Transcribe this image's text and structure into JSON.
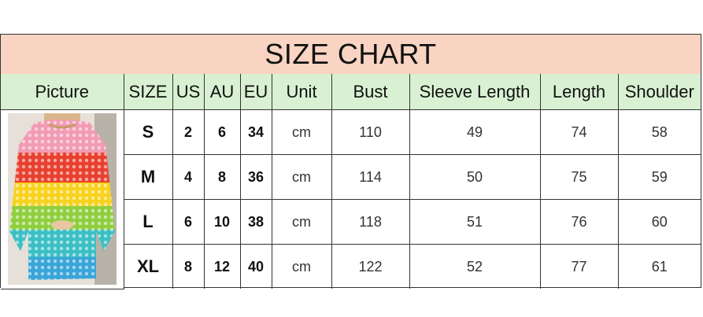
{
  "title": "SIZE CHART",
  "headers": [
    "Picture",
    "SIZE",
    "US",
    "AU",
    "EU",
    "Unit",
    "Bust",
    "Sleeve Length",
    "Length",
    "Shoulder"
  ],
  "rows": [
    {
      "size": "S",
      "us": "2",
      "au": "6",
      "eu": "34",
      "unit": "cm",
      "bust": "110",
      "sleeve": "49",
      "length": "74",
      "shoulder": "58"
    },
    {
      "size": "M",
      "us": "4",
      "au": "8",
      "eu": "36",
      "unit": "cm",
      "bust": "114",
      "sleeve": "50",
      "length": "75",
      "shoulder": "59"
    },
    {
      "size": "L",
      "us": "6",
      "au": "10",
      "eu": "38",
      "unit": "cm",
      "bust": "118",
      "sleeve": "51",
      "length": "76",
      "shoulder": "60"
    },
    {
      "size": "XL",
      "us": "8",
      "au": "12",
      "eu": "40",
      "unit": "cm",
      "bust": "122",
      "sleeve": "52",
      "length": "77",
      "shoulder": "61"
    }
  ],
  "colors": {
    "title_bg": "#f9d4c3",
    "header_bg": "#d9f1d2",
    "border": "#333333"
  },
  "picture": {
    "icon": "rainbow-crochet-sweater-photo"
  }
}
